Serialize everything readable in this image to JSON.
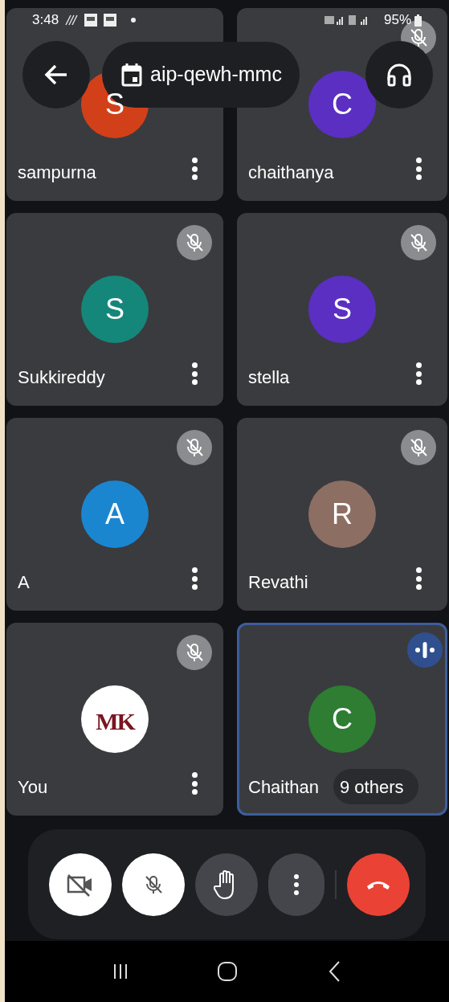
{
  "status_bar": {
    "time": "3:48",
    "battery": "95%"
  },
  "header": {
    "meeting_code": "aip-qewh-mmc"
  },
  "tiles": [
    {
      "name": "sampurna",
      "kind": "initial",
      "initial": "S",
      "color": "#d2401a",
      "muted": false,
      "speaking": false
    },
    {
      "name": "chaithanya",
      "kind": "initial",
      "initial": "C",
      "color": "#5a2fc2",
      "muted": true,
      "speaking": false
    },
    {
      "name": "Sukkireddy",
      "kind": "initial",
      "initial": "S",
      "color": "#14877a",
      "muted": true,
      "speaking": false
    },
    {
      "name": "stella",
      "kind": "initial",
      "initial": "S",
      "color": "#5a2fc2",
      "muted": true,
      "speaking": false
    },
    {
      "name": "A",
      "kind": "initial",
      "initial": "A",
      "color": "#1b86d0",
      "muted": true,
      "speaking": false
    },
    {
      "name": "Revathi",
      "kind": "initial",
      "initial": "R",
      "color": "#8d6e63",
      "muted": true,
      "speaking": false
    },
    {
      "name": "You",
      "kind": "logo",
      "logo_text": "MK",
      "muted": true,
      "speaking": false
    },
    {
      "name": "Chaithan",
      "kind": "initial",
      "initial": "C",
      "color": "#2e7d32",
      "muted": false,
      "speaking": true,
      "overlay_chip": "9 others"
    }
  ],
  "controls": [
    {
      "kind": "camera",
      "on": false
    },
    {
      "kind": "mic",
      "on": false
    },
    {
      "kind": "hand",
      "on": false
    },
    {
      "kind": "more"
    },
    {
      "kind": "hangup"
    }
  ]
}
